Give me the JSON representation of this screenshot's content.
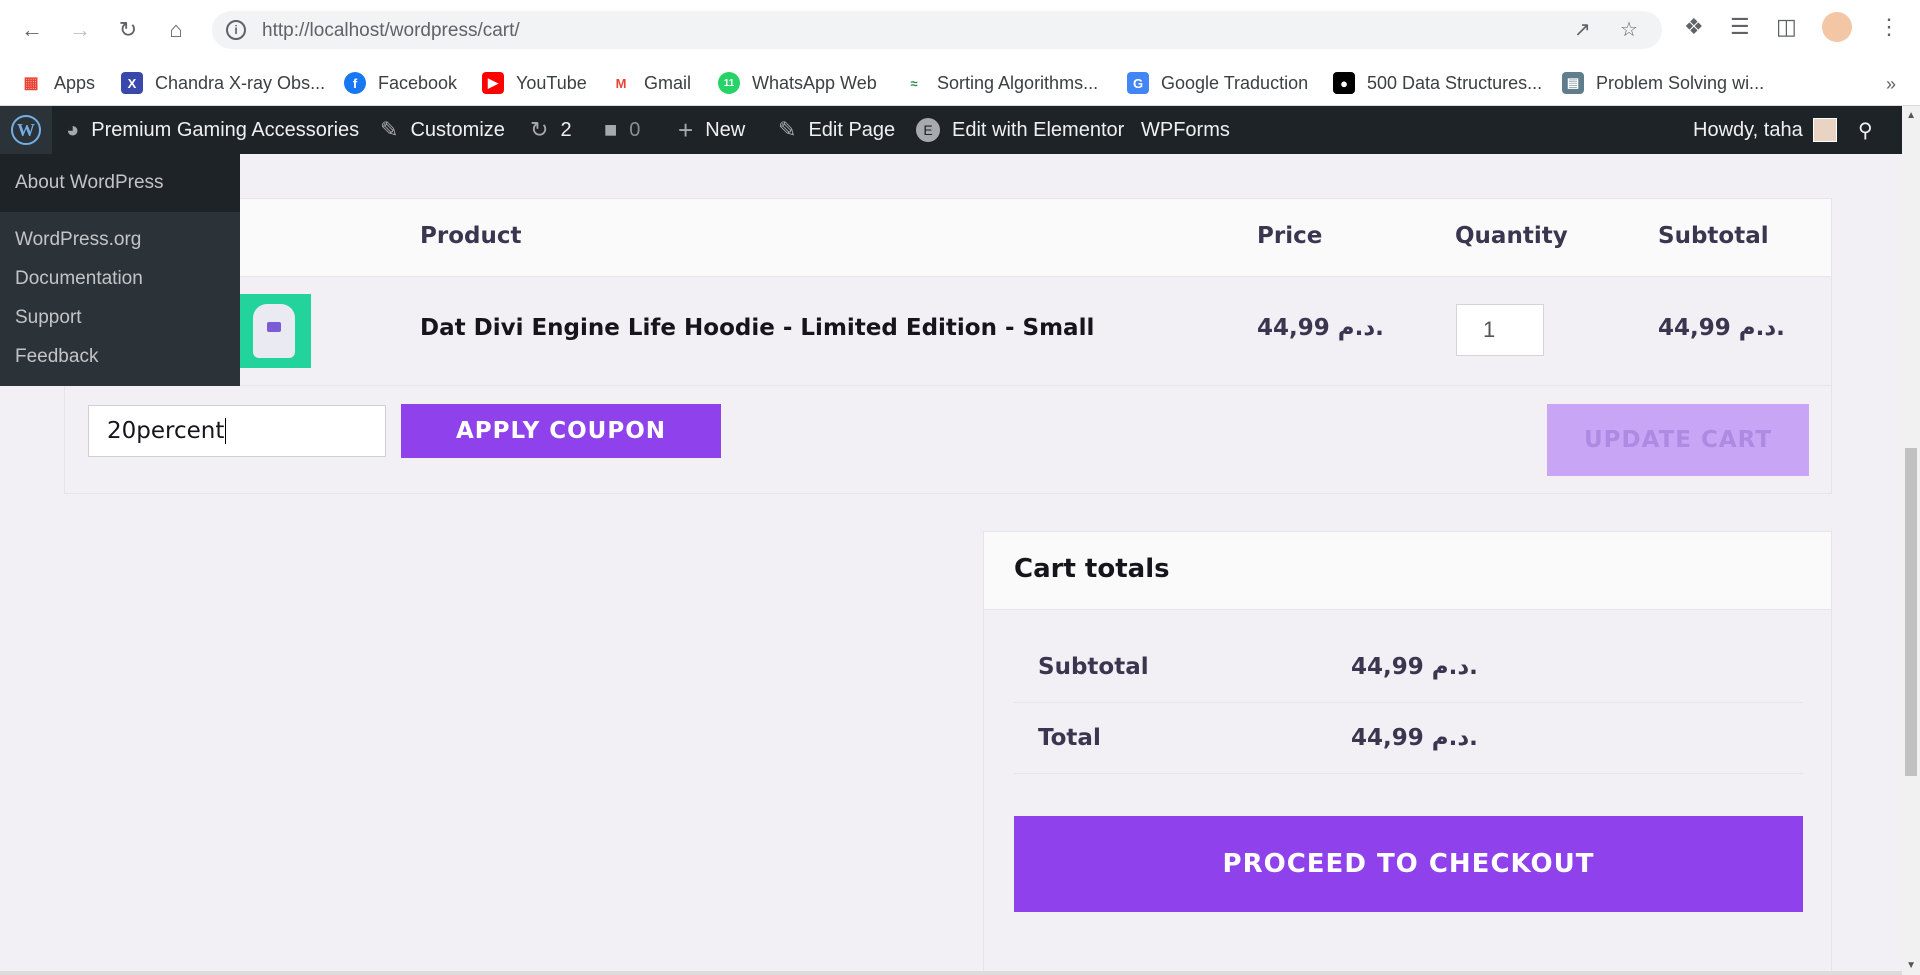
{
  "browser": {
    "url_host": "http://localhost",
    "url_path": "/wordpress/cart/",
    "bookmarks": [
      {
        "label": "Apps",
        "icon": "apps-grid-icon",
        "color": "#ea4335"
      },
      {
        "label": "Chandra X-ray Obs...",
        "icon": "chandra-icon",
        "color": "#3949ab"
      },
      {
        "label": "Facebook",
        "icon": "facebook-icon",
        "color": "#1877f2"
      },
      {
        "label": "YouTube",
        "icon": "youtube-icon",
        "color": "#ff0000"
      },
      {
        "label": "Gmail",
        "icon": "gmail-icon",
        "color": "#ea4335"
      },
      {
        "label": "WhatsApp Web",
        "icon": "whatsapp-icon",
        "color": "#25d366"
      },
      {
        "label": "Sorting Algorithms...",
        "icon": "geeksforgeeks-icon",
        "color": "#2f8d46"
      },
      {
        "label": "Google Traduction",
        "icon": "google-translate-icon",
        "color": "#4285f4"
      },
      {
        "label": "500 Data Structures...",
        "icon": "medium-icon",
        "color": "#000000"
      },
      {
        "label": "Problem Solving wi...",
        "icon": "book-icon",
        "color": "#607d8b"
      }
    ]
  },
  "adminbar": {
    "site_name": "Premium Gaming Accessories",
    "customize": "Customize",
    "updates_count": "2",
    "comments_count": "0",
    "new": "New",
    "edit_page": "Edit Page",
    "edit_elementor": "Edit with Elementor",
    "wpforms": "WPForms",
    "howdy": "Howdy, taha"
  },
  "wp_menu": {
    "about": "About WordPress",
    "links": [
      "WordPress.org",
      "Documentation",
      "Support",
      "Feedback"
    ]
  },
  "cart": {
    "headers": {
      "product": "Product",
      "price": "Price",
      "quantity": "Quantity",
      "subtotal": "Subtotal"
    },
    "item": {
      "name": "Dat Divi Engine Life Hoodie - Limited Edition - Small",
      "price": "44,99 د.م.",
      "quantity": "1",
      "subtotal": "44,99 د.م."
    },
    "coupon_value": "20percent",
    "apply_coupon": "APPLY COUPON",
    "update_cart": "UPDATE CART"
  },
  "totals": {
    "title": "Cart totals",
    "subtotal_label": "Subtotal",
    "subtotal_value": "44,99 د.م.",
    "total_label": "Total",
    "total_value": "44,99 د.م.",
    "checkout": "PROCEED TO CHECKOUT"
  },
  "colors": {
    "accent": "#8f42ec",
    "accent_disabled": "#c9a6f5",
    "admin_bar": "#1d2327"
  }
}
